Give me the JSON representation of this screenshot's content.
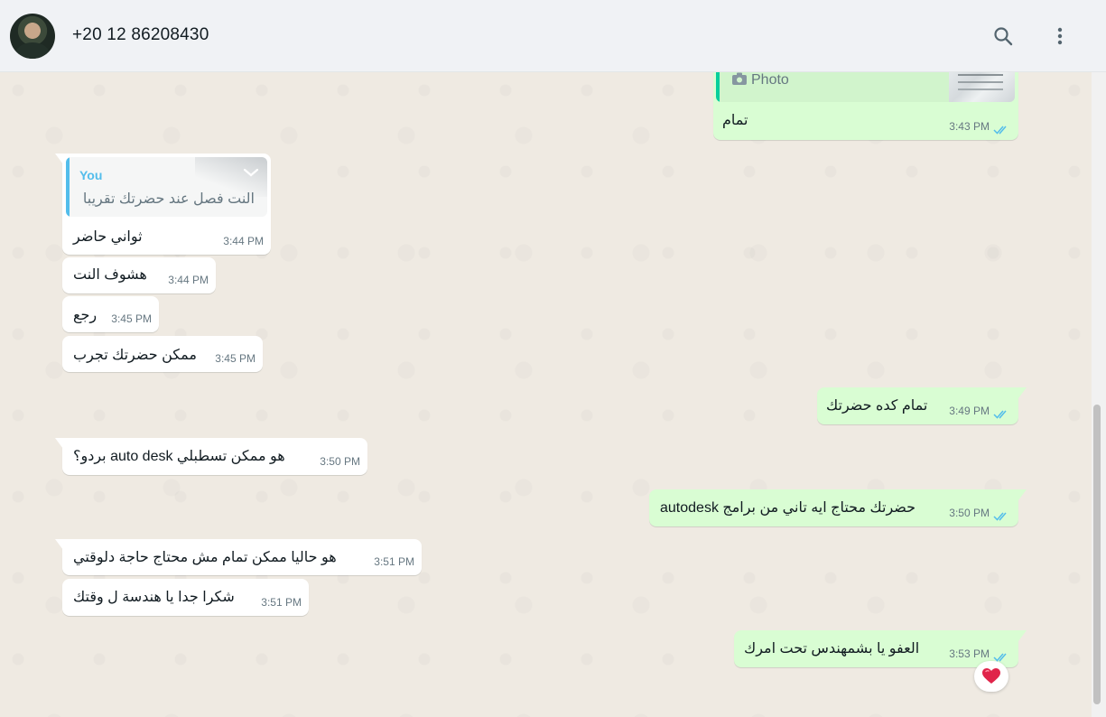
{
  "header": {
    "contact": "+20 12 86208430",
    "search_icon": "search-icon",
    "menu_icon": "kebab-menu-icon"
  },
  "colors": {
    "incoming": "#ffffff",
    "outgoing": "#d9fdd3",
    "read_ticks": "#53bdeb",
    "quote_accent": "#53bdeb",
    "photo_quote_accent": "#06cf9c"
  },
  "messages": [
    {
      "dir": "out",
      "quote_label": "Photo",
      "text": "تمام",
      "time": "3:43 PM",
      "ticks": "read"
    },
    {
      "dir": "in",
      "quote_author": "You",
      "quote_text": "النت فصل عند حضرتك تقريبا",
      "text": "ثواني حاضر",
      "time": "3:44 PM"
    },
    {
      "dir": "in",
      "text": "هشوف النت",
      "time": "3:44 PM"
    },
    {
      "dir": "in",
      "text": "رجع",
      "time": "3:45 PM"
    },
    {
      "dir": "in",
      "text": "ممكن حضرتك تجرب",
      "time": "3:45 PM"
    },
    {
      "dir": "out",
      "text": "تمام كده حضرتك",
      "time": "3:49 PM",
      "ticks": "read"
    },
    {
      "dir": "in",
      "text": "هو ممكن تسطبلي auto desk بردو؟",
      "time": "3:50 PM"
    },
    {
      "dir": "out",
      "text": "حضرتك محتاج ايه تاني من برامج autodesk",
      "time": "3:50 PM",
      "ticks": "read"
    },
    {
      "dir": "in",
      "text": "هو حاليا ممكن تمام مش محتاج حاجة دلوقتي",
      "time": "3:51 PM"
    },
    {
      "dir": "in",
      "text": "شكرا جدا يا هندسة ل وقتك",
      "time": "3:51 PM"
    },
    {
      "dir": "out",
      "text": "العفو يا بشمهندس تحت امرك",
      "time": "3:53 PM",
      "ticks": "read",
      "reaction": "❤️"
    }
  ]
}
